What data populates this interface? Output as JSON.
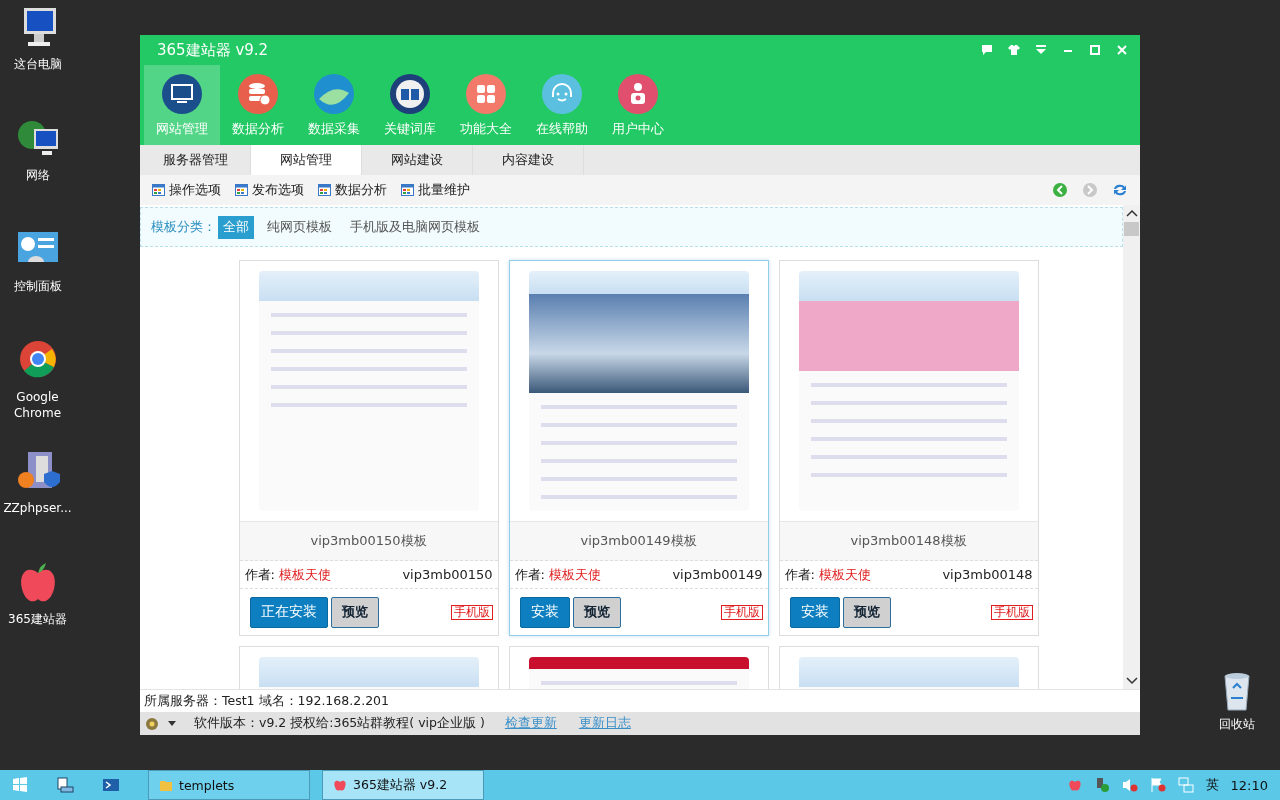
{
  "desktop_icons": [
    {
      "label": "这台电脑",
      "kind": "computer"
    },
    {
      "label": "网络",
      "kind": "network"
    },
    {
      "label": "控制面板",
      "kind": "panel"
    },
    {
      "label": "Google Chrome",
      "kind": "chrome"
    },
    {
      "label": "ZZphpser...",
      "kind": "server"
    },
    {
      "label": "365建站器",
      "kind": "apple"
    }
  ],
  "recycle_bin": {
    "label": "回收站"
  },
  "window": {
    "title": "365建站器 v9.2"
  },
  "nav": [
    {
      "label": "网站管理",
      "kind": "monitor",
      "color": "#1a4f8c",
      "selected": true
    },
    {
      "label": "数据分析",
      "kind": "database",
      "color": "#e8604c",
      "selected": false
    },
    {
      "label": "数据采集",
      "kind": "globe",
      "color": "#1f8fd0",
      "selected": false
    },
    {
      "label": "关键词库",
      "kind": "book",
      "color": "#1d3f7a",
      "selected": false
    },
    {
      "label": "功能大全",
      "kind": "grid",
      "color": "#f37a6a",
      "selected": false
    },
    {
      "label": "在线帮助",
      "kind": "headset",
      "color": "#5bc0e0",
      "selected": false
    },
    {
      "label": "用户中心",
      "kind": "user",
      "color": "#e0506e",
      "selected": false
    }
  ],
  "tabs": [
    {
      "label": "服务器管理",
      "selected": false
    },
    {
      "label": "网站管理",
      "selected": true
    },
    {
      "label": "网站建设",
      "selected": false
    },
    {
      "label": "内容建设",
      "selected": false
    }
  ],
  "toolbar": [
    "操作选项",
    "发布选项",
    "数据分析",
    "批量维护"
  ],
  "filter": {
    "label": "模板分类：",
    "options": [
      {
        "label": "全部",
        "selected": true
      },
      {
        "label": "纯网页模板",
        "selected": false
      },
      {
        "label": "手机版及电脑网页模板",
        "selected": false
      }
    ]
  },
  "cards": [
    {
      "name": "vip3mb00150模板",
      "author_label": "作者:",
      "author": "模板天使",
      "code": "vip3mb00150",
      "install": "正在安装",
      "preview": "预览",
      "tag": "手机版",
      "selected": false,
      "kind": "plain"
    },
    {
      "name": "vip3mb00149模板",
      "author_label": "作者:",
      "author": "模板天使",
      "code": "vip3mb00149",
      "install": "安装",
      "preview": "预览",
      "tag": "手机版",
      "selected": true,
      "kind": "photo"
    },
    {
      "name": "vip3mb00148模板",
      "author_label": "作者:",
      "author": "模板天使",
      "code": "vip3mb00148",
      "install": "安装",
      "preview": "预览",
      "tag": "手机版",
      "selected": false,
      "kind": "pink"
    },
    {
      "kind": "plain",
      "selected": false
    },
    {
      "kind": "red",
      "selected": false
    },
    {
      "kind": "plain",
      "selected": false
    }
  ],
  "status": {
    "server": "所属服务器：Test1 域名：192.168.2.201",
    "version": "软件版本：v9.2  授权给:365站群教程( vip企业版 )",
    "links": [
      "检查更新",
      "更新日志"
    ]
  },
  "taskbar": {
    "tasks": [
      {
        "label": "templets",
        "selected": false
      },
      {
        "label": "365建站器 v9.2",
        "selected": true
      }
    ],
    "ime": "英",
    "time": "12:10"
  }
}
